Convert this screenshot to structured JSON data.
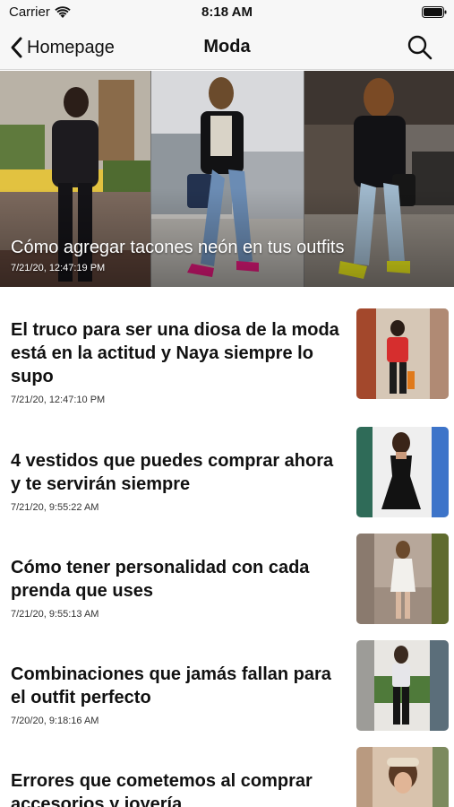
{
  "status_bar": {
    "carrier": "Carrier",
    "time": "8:18 AM"
  },
  "nav": {
    "back_label": "Homepage",
    "title": "Moda"
  },
  "hero": {
    "title": "Cómo agregar tacones neón en tus outfits",
    "date": "7/21/20, 12:47:19 PM"
  },
  "articles": [
    {
      "title": "El truco para ser una diosa de la moda está en la actitud y Naya siempre lo supo",
      "date": "7/21/20, 12:47:10 PM"
    },
    {
      "title": "4 vestidos que puedes comprar ahora y te servirán siempre",
      "date": "7/21/20, 9:55:22 AM"
    },
    {
      "title": "Cómo tener personalidad con cada prenda que uses",
      "date": "7/21/20, 9:55:13 AM"
    },
    {
      "title": "Combinaciones que jamás fallan para el outfit perfecto",
      "date": "7/20/20, 9:18:16 AM"
    },
    {
      "title": "Errores que cometemos al comprar accesorios y joyería",
      "date": ""
    }
  ],
  "colors": {
    "bar_background": "#f7f7f7",
    "text": "#111111",
    "neon_heels_pink": "#e0187a",
    "neon_heels_yellow": "#e6e61a"
  }
}
